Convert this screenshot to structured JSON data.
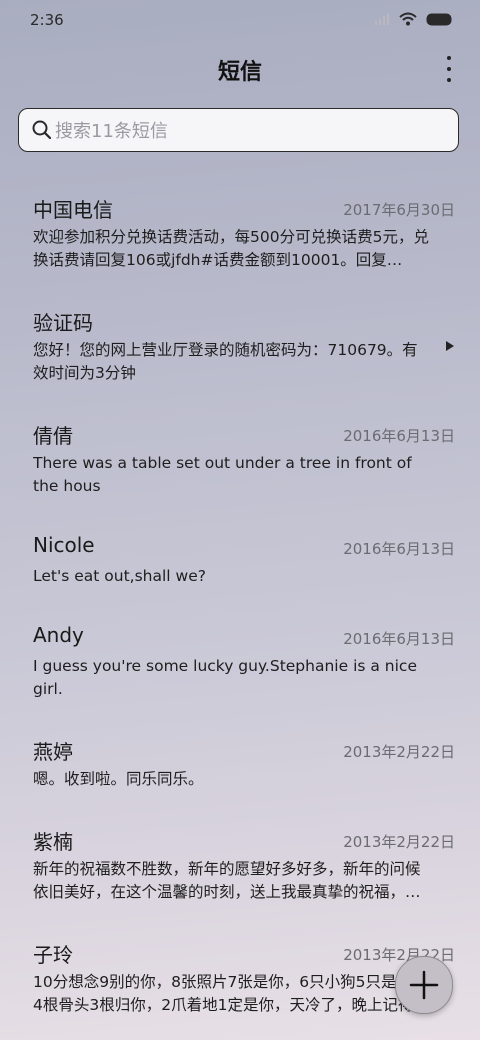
{
  "status_bar": {
    "time": "2:36",
    "icons": [
      "signal-icon",
      "wifi-icon",
      "battery-icon"
    ]
  },
  "header": {
    "title": "短信",
    "more_icon": "more-vertical-icon"
  },
  "search": {
    "placeholder": "搜索11条短信",
    "icon": "search-icon"
  },
  "messages": [
    {
      "name": "中国电信",
      "date": "2017年6月30日",
      "preview": "欢迎参加积分兑换话费活动，每500分可兑换话费5元，兑换话费请回复106或jfdh#话费金额到10001。回复…"
    },
    {
      "name": "验证码",
      "date": "",
      "preview": "您好！您的网上营业厅登录的随机密码为：710679。有效时间为3分钟"
    },
    {
      "name": "倩倩",
      "date": "2016年6月13日",
      "preview": "There was a table set out under a tree in front of the hous"
    },
    {
      "name": "Nicole",
      "date": "2016年6月13日",
      "preview": "Let's eat out,shall we?"
    },
    {
      "name": "Andy",
      "date": "2016年6月13日",
      "preview": "I guess you're some lucky guy.Stephanie is a nice girl."
    },
    {
      "name": "燕婷",
      "date": "2013年2月22日",
      "preview": "嗯。收到啦。同乐同乐。"
    },
    {
      "name": "紫楠",
      "date": "2013年2月22日",
      "preview": "新年的祝福数不胜数，新年的愿望好多好多，新年的问候依旧美好，在这个温馨的时刻，送上我最真挚的祝福，…"
    },
    {
      "name": "子玲",
      "date": "2013年2月22日",
      "preview": "10分想念9别的你，8张照片7张是你，6只小狗5只是你，4根骨头3根归你，2爪着地1定是你，天冷了，晚上记得…"
    }
  ],
  "fab": {
    "icon": "plus-icon"
  },
  "colors": {
    "background_top": "#a9adc0",
    "background_bottom": "#e8e0e6",
    "text_primary": "#1a1a1a",
    "text_secondary": "#6b6b72"
  }
}
